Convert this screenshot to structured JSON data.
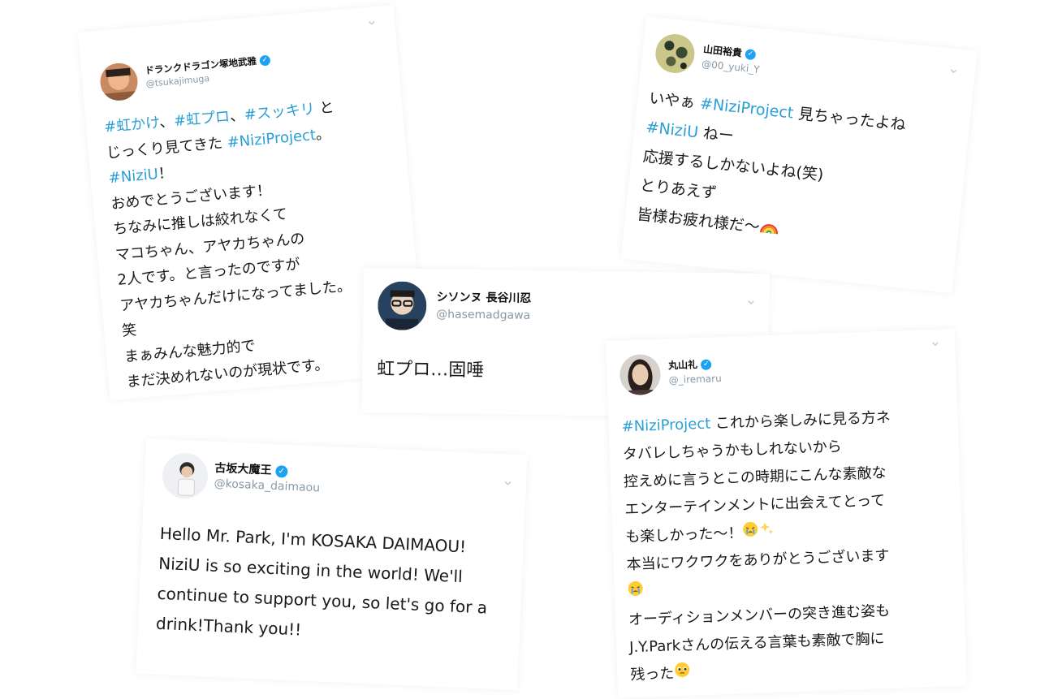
{
  "tweets": {
    "t1": {
      "name": "ドランクドラゴン塚地武雅",
      "handle": "@tsukajimuga",
      "verified": true,
      "lines": [
        [
          "#虹かけ",
          "、",
          "#虹プロ",
          "、",
          "#スッキリ",
          " と"
        ],
        [
          "じっくり見てきた ",
          "#NiziProject",
          "。"
        ],
        [
          "#NiziU",
          "！"
        ],
        [
          "おめでとうございます！"
        ],
        [
          "ちなみに推しは絞れなくて"
        ],
        [
          "マコちゃん、アヤカちゃんの"
        ],
        [
          "2人です。と言ったのですが"
        ],
        [
          "アヤカちゃんだけになってました。"
        ],
        [
          "笑"
        ],
        [
          "まぁみんな魅力的で"
        ],
        [
          "まだ決めれないのが現状です。"
        ]
      ]
    },
    "t2": {
      "name": "山田裕貴",
      "handle": "@00_yuki_Y",
      "verified": true,
      "lines": [
        [
          "いやぁ ",
          "#NiziProject",
          " 見ちゃったよね"
        ],
        [
          "#NiziU",
          " ねー"
        ],
        [
          "応援するしかないよね(笑)"
        ],
        [
          "とりあえず"
        ],
        [
          "皆様お疲れ様だ〜"
        ]
      ]
    },
    "t3": {
      "name": "シソンヌ 長谷川忍",
      "handle": "@hasemadgawa",
      "verified": false,
      "text": "虹プロ…固唾"
    },
    "t4": {
      "name": "丸山礼",
      "handle": "@_iremaru",
      "verified": true,
      "lines": [
        [
          "#NiziProject",
          " これから楽しみに見る方ネ"
        ],
        [
          "タバレしちゃうかもしれないから"
        ],
        [
          "控えめに言うとこの時期にこんな素敵な"
        ],
        [
          "エンターテインメントに出会えてとって"
        ],
        [
          "も楽しかった〜！"
        ],
        [
          "本当にワクワクをありがとうございます"
        ],
        [
          ""
        ],
        [
          "オーディションメンバーの突き進む姿も"
        ],
        [
          "J.Y.Parkさんの伝える言葉も素敵で胸に"
        ],
        [
          "残った"
        ]
      ]
    },
    "t5": {
      "name": "古坂大魔王",
      "handle": "@kosaka_daimaou",
      "verified": true,
      "lines": [
        "Hello Mr. Park, I'm KOSAKA DAIMAOU!",
        "NiziU is so exciting in the world! We'll",
        "continue to support you, so let's go for a",
        "drink!Thank you!!"
      ]
    }
  },
  "icons": {
    "verified": "✓",
    "chevron": "⌄"
  },
  "colors": {
    "hashtag": "#2a9fd6",
    "handle": "#8899a6",
    "verified": "#1da1f2"
  }
}
